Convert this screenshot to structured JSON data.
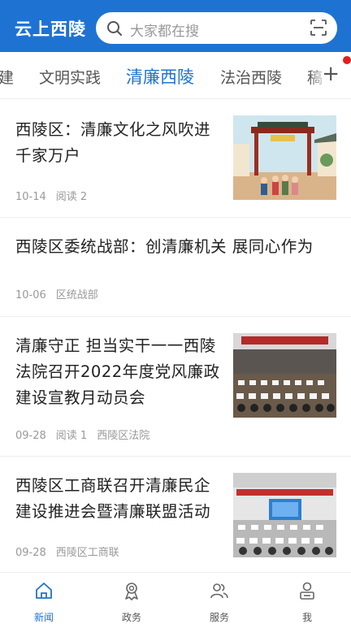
{
  "header": {
    "app_title": "云上西陵",
    "search_placeholder": "大家都在搜"
  },
  "tabs": [
    {
      "label": "建",
      "active": false
    },
    {
      "label": "文明实践",
      "active": false
    },
    {
      "label": "清廉西陵",
      "active": true
    },
    {
      "label": "法治西陵",
      "active": false
    },
    {
      "label": "稿",
      "active": false
    }
  ],
  "feed": [
    {
      "title": "西陵区：清廉文化之风吹进千家万户",
      "date": "10-14",
      "reads": "阅读 2",
      "source": ""
    },
    {
      "title": "西陵区委统战部：创清廉机关 展同心作为",
      "date": "10-06",
      "reads": "",
      "source": "区统战部"
    },
    {
      "title": "清廉守正 担当实干一一西陵法院召开2022年度党风廉政建设宣教月动员会",
      "date": "09-28",
      "reads": "阅读 1",
      "source": "西陵区法院"
    },
    {
      "title": "西陵区工商联召开清廉民企建设推进会暨清廉联盟活动",
      "date": "09-28",
      "reads": "",
      "source": "西陵区工商联"
    }
  ],
  "bottom_nav": [
    {
      "label": "新闻",
      "icon": "home-icon",
      "active": true
    },
    {
      "label": "政务",
      "icon": "badge-icon",
      "active": false
    },
    {
      "label": "服务",
      "icon": "people-icon",
      "active": false
    },
    {
      "label": "我",
      "icon": "user-icon",
      "active": false
    }
  ],
  "colors": {
    "brand": "#1e73d2",
    "badge": "#e02020"
  }
}
